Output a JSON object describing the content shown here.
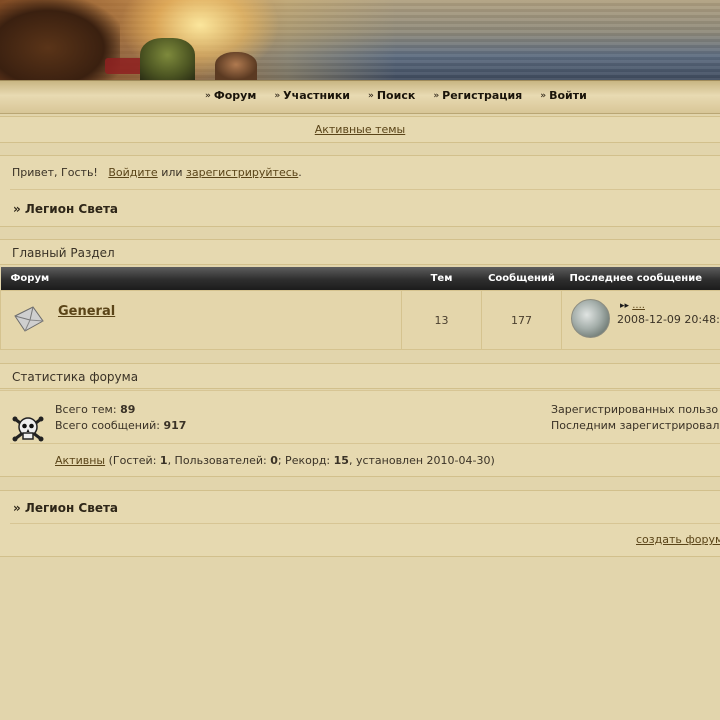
{
  "nav": {
    "items": [
      "Форум",
      "Участники",
      "Поиск",
      "Регистрация",
      "Войти"
    ]
  },
  "active_topics": "Активные темы",
  "greeting": {
    "text": "Привет, Гость!",
    "login_link": "Войдите",
    "or": "или",
    "register_link": "зарегистрируйтесь",
    "period": "."
  },
  "breadcrumb": "» Легион Света",
  "section": {
    "title": "Главный Раздел",
    "columns": [
      "Форум",
      "Тем",
      "Сообщений",
      "Последнее сообщение"
    ],
    "forums": [
      {
        "name": "General",
        "topics": "13",
        "posts": "177",
        "last_post_link": "....",
        "last_post_date": "2008-12-09 20:48:"
      }
    ]
  },
  "stats": {
    "title": "Статистика форума",
    "total_topics_label": "Всего тем:",
    "total_topics": "89",
    "total_posts_label": "Всего сообщений:",
    "total_posts": "917",
    "registered_label": "Зарегистрированных пользо",
    "last_registered_label": "Последним зарегистрировал",
    "online_link": "Активны",
    "online_text_1": "(Гостей:",
    "guests": "1",
    "online_text_2": ", Пользователей:",
    "users": "0",
    "online_text_3": "; Рекорд:",
    "record": "15",
    "online_text_4": ", установлен 2010-04-30)"
  },
  "footer": {
    "breadcrumb": "» Легион Света",
    "create_forum_link": "создать форум"
  }
}
